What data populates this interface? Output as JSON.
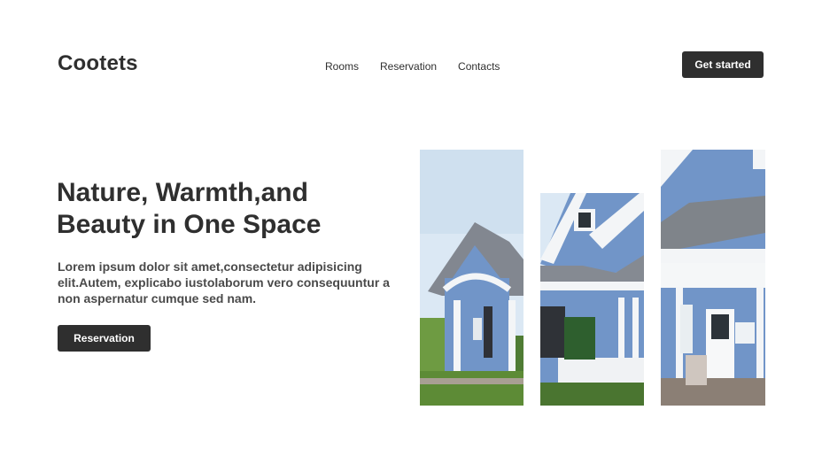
{
  "brand": {
    "name": "Cootets"
  },
  "nav": {
    "items": [
      {
        "label": "Rooms"
      },
      {
        "label": "Reservation"
      },
      {
        "label": "Contacts"
      }
    ]
  },
  "header": {
    "cta_label": "Get started"
  },
  "hero": {
    "title": "Nature, Warmth,and Beauty in One Space",
    "description": "Lorem ipsum dolor sit amet,consectetur adipisicing elit.Autem, explicabo iustolaborum vero consequuntur a non aspernatur cumque sed nam.",
    "button_label": "Reservation"
  },
  "colors": {
    "text": "#2f2f2f",
    "button_bg": "#2f2f2f",
    "button_text": "#ffffff",
    "house_siding": "#6d8fc2",
    "house_trim": "#f4f6f7",
    "roof": "#7f8489",
    "sky": "#dbe8f4",
    "grass": "#5d8b36"
  }
}
